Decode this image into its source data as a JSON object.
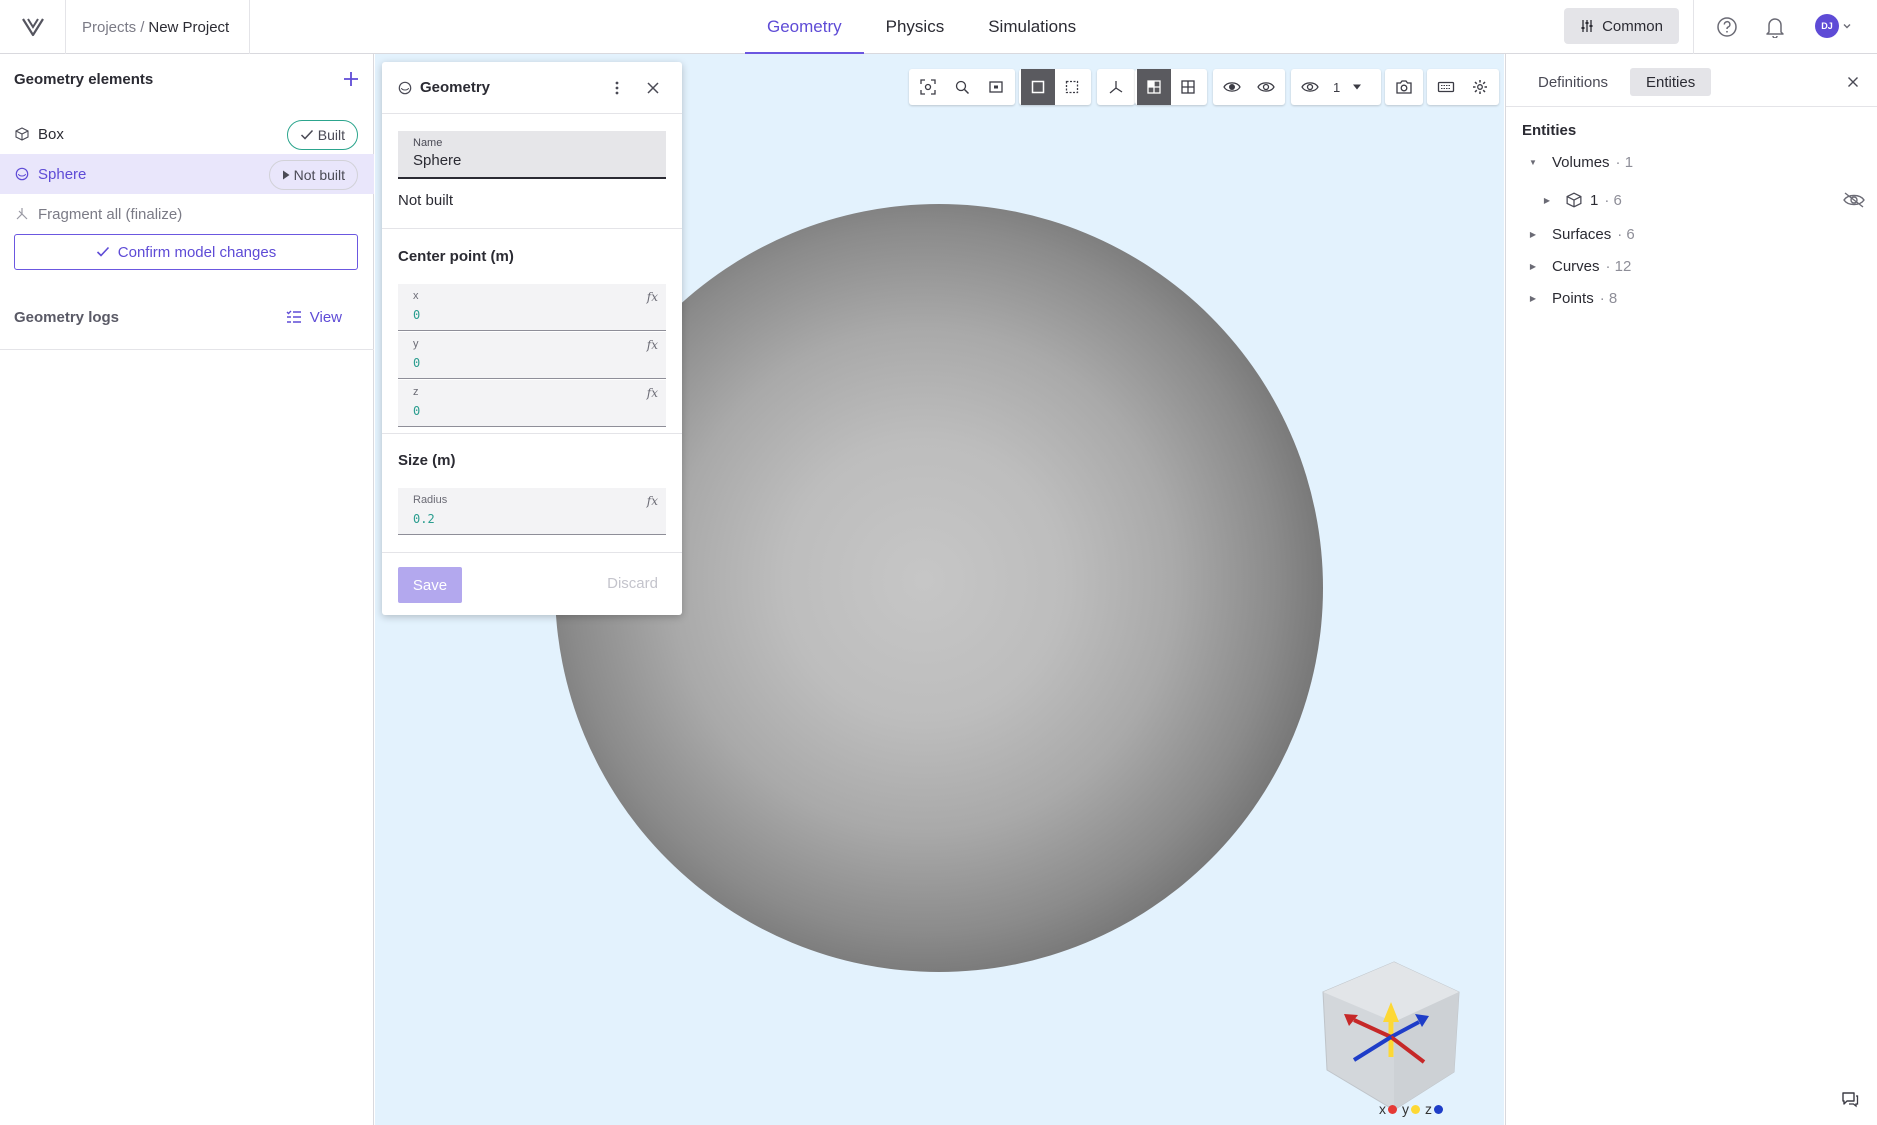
{
  "topbar": {
    "breadcrumb": {
      "parent": "Projects",
      "separator": "/",
      "current": "New Project"
    },
    "tabs": [
      {
        "label": "Geometry",
        "active": true
      },
      {
        "label": "Physics",
        "active": false
      },
      {
        "label": "Simulations",
        "active": false
      }
    ],
    "common_label": "Common",
    "avatar_initials": "DJ"
  },
  "left": {
    "title": "Geometry elements",
    "elements": [
      {
        "label": "Box",
        "status": "Built",
        "icon": "cube-icon"
      },
      {
        "label": "Sphere",
        "status": "Not built",
        "icon": "sphere-icon",
        "selected": true
      },
      {
        "label": "Fragment all (finalize)",
        "icon": "fragment-icon"
      }
    ],
    "confirm_label": "Confirm model changes",
    "logs_title": "Geometry logs",
    "logs_view": "View"
  },
  "panel": {
    "title": "Geometry",
    "name_label": "Name",
    "name_value": "Sphere",
    "status": "Not built",
    "center_title": "Center point (m)",
    "fields": [
      {
        "label": "x",
        "value": "0"
      },
      {
        "label": "y",
        "value": "0"
      },
      {
        "label": "z",
        "value": "0"
      }
    ],
    "size_title": "Size (m)",
    "radius_label": "Radius",
    "radius_value": "0.2",
    "save_label": "Save",
    "discard_label": "Discard"
  },
  "viewport": {
    "visibility_level": "1",
    "axes": [
      "x",
      "y",
      "z"
    ],
    "axis_colors": [
      "#e53935",
      "#fdd835",
      "#1e3dc8"
    ],
    "background": "#e3f2fd"
  },
  "right": {
    "tabs": [
      {
        "label": "Definitions",
        "active": false
      },
      {
        "label": "Entities",
        "active": true
      }
    ],
    "title": "Entities",
    "tree": {
      "volumes": {
        "label": "Volumes",
        "count": "· 1"
      },
      "volume_item": {
        "label": "1",
        "count": "· 6"
      },
      "surfaces": {
        "label": "Surfaces",
        "count": "· 6"
      },
      "curves": {
        "label": "Curves",
        "count": "· 12"
      },
      "points": {
        "label": "Points",
        "count": "· 8"
      }
    }
  },
  "colors": {
    "accent": "#5e4bd6",
    "built": "#2ca58d",
    "value_text": "#2a9d8f"
  }
}
